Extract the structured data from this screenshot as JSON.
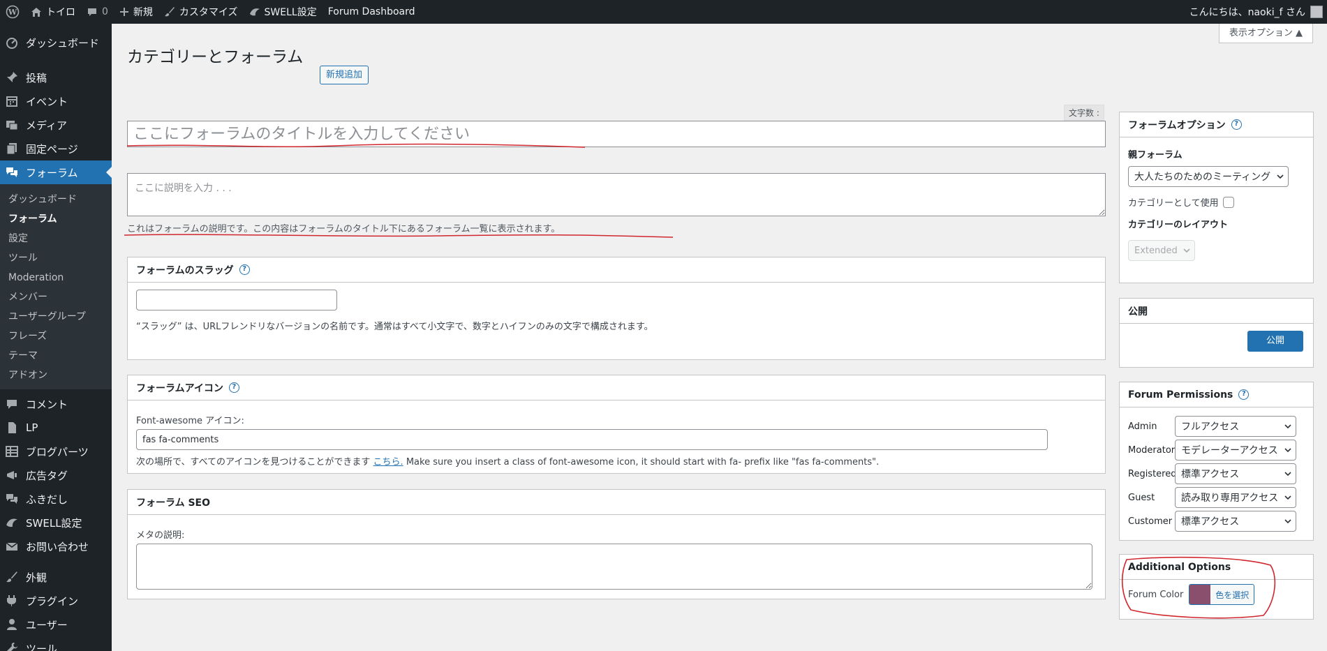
{
  "admin_bar": {
    "site_name": "トイロ",
    "comments_count": "0",
    "new_label": "新規",
    "customize_label": "カスタマイズ",
    "swell_label": "SWELL設定",
    "forum_dashboard_label": "Forum Dashboard",
    "greeting": "こんにちは、naoki_f さん"
  },
  "sidebar": {
    "items_top": [
      {
        "label": "ダッシュボード",
        "icon": "dashboard-icon"
      },
      {
        "label": "投稿",
        "icon": "pin-icon"
      },
      {
        "label": "イベント",
        "icon": "calendar-icon"
      },
      {
        "label": "メディア",
        "icon": "media-icon"
      },
      {
        "label": "固定ページ",
        "icon": "page-icon"
      },
      {
        "label": "フォーラム",
        "icon": "forum-icon"
      }
    ],
    "submenu": [
      "ダッシュボード",
      "フォーラム",
      "設定",
      "ツール",
      "Moderation",
      "メンバー",
      "ユーザーグループ",
      "フレーズ",
      "テーマ",
      "アドオン"
    ],
    "items_bottom": [
      {
        "label": "コメント",
        "icon": "comment-icon"
      },
      {
        "label": "LP",
        "icon": "document-icon"
      },
      {
        "label": "ブログパーツ",
        "icon": "grid-icon"
      },
      {
        "label": "広告タグ",
        "icon": "ad-icon"
      },
      {
        "label": "ふきだし",
        "icon": "bubble-icon"
      },
      {
        "label": "SWELL設定",
        "icon": "swell-icon"
      },
      {
        "label": "お問い合わせ",
        "icon": "mail-icon"
      },
      {
        "label": "外観",
        "icon": "brush-icon"
      },
      {
        "label": "プラグイン",
        "icon": "plugin-icon"
      },
      {
        "label": "ユーザー",
        "icon": "user-icon"
      },
      {
        "label": "ツール",
        "icon": "wrench-icon"
      }
    ]
  },
  "header": {
    "screen_options": "表示オプション ▲",
    "page_title": "カテゴリーとフォーラム",
    "add_new": "新規追加"
  },
  "editor": {
    "char_count_label": "文字数 :",
    "title_placeholder": "ここにフォーラムのタイトルを入力してください",
    "desc_placeholder": "ここに説明を入力 . . .",
    "desc_help": "これはフォーラムの説明です。この内容はフォーラムのタイトル下にあるフォーラム一覧に表示されます。"
  },
  "slug_box": {
    "title": "フォーラムのスラッグ",
    "value": "",
    "help": "“スラッグ” は、URLフレンドリなバージョンの名前です。通常はすべて小文字で、数字とハイフンのみの文字で構成されます。"
  },
  "icon_box": {
    "title": "フォーラムアイコン",
    "label": "Font-awesome アイコン:",
    "value": "fas fa-comments",
    "help_prefix": "次の場所で、すべてのアイコンを見つけることができます",
    "help_link": "こちら.",
    "help_suffix": "Make sure you insert a class of font-awesome icon, it should start with fa- prefix like \"fas fa-comments\"."
  },
  "seo_box": {
    "title": "フォーラム SEO",
    "meta_label": "メタの説明:",
    "meta_value": ""
  },
  "forum_options": {
    "title": "フォーラムオプション",
    "parent_label": "親フォーラム",
    "parent_value": "大人たちのためのミーティング",
    "category_label": "カテゴリーとして使用",
    "layout_label": "カテゴリーのレイアウト",
    "layout_value": "Extended"
  },
  "publish": {
    "title": "公開",
    "button": "公開"
  },
  "permissions": {
    "title": "Forum Permissions",
    "rows": [
      {
        "role": "Admin",
        "value": "フルアクセス"
      },
      {
        "role": "Moderator",
        "value": "モデレーターアクセス"
      },
      {
        "role": "Registered",
        "value": "標準アクセス"
      },
      {
        "role": "Guest",
        "value": "読み取り専用アクセス"
      },
      {
        "role": "Customer",
        "value": "標準アクセス"
      }
    ]
  },
  "additional": {
    "title": "Additional Options",
    "color_label": "Forum Color",
    "color_button": "色を選択",
    "color_value": "#8b4f6e"
  },
  "colors": {
    "admin_dark": "#1d2327",
    "accent": "#2271b1",
    "annotation": "#d0262d"
  }
}
